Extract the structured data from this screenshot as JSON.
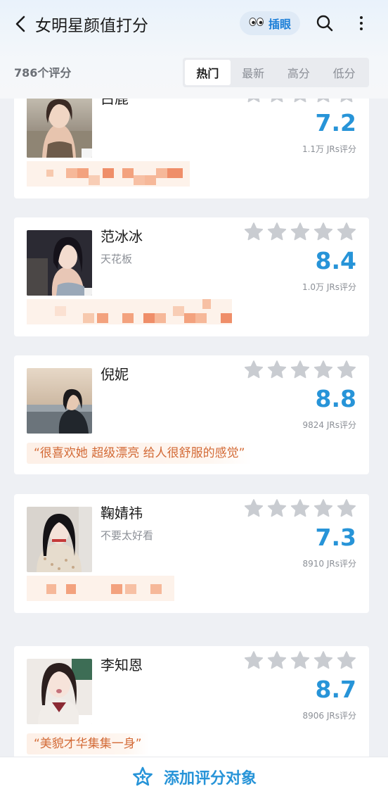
{
  "header": {
    "title": "女明星颜值打分",
    "eye_button_label": "插眼",
    "back_icon": "chevron-left-icon",
    "search_icon": "search-icon",
    "more_icon": "more-vertical-icon"
  },
  "summary": {
    "rating_count": "786个评分"
  },
  "tabs": [
    {
      "label": "热门",
      "active": true
    },
    {
      "label": "最新",
      "active": false
    },
    {
      "label": "高分",
      "active": false
    },
    {
      "label": "低分",
      "active": false
    }
  ],
  "colors": {
    "accent": "#2794d8",
    "star_inactive": "#c9ccd1",
    "comment_text": "#d36a36",
    "comment_bg": "#fdf0e7"
  },
  "items": [
    {
      "name": "白鹿",
      "subtitle": "",
      "score": "7.2",
      "raters": "1.1万 JRs评分",
      "comment": "",
      "comment_blurred": true
    },
    {
      "name": "范冰冰",
      "subtitle": "天花板",
      "score": "8.4",
      "raters": "1.0万 JRs评分",
      "comment": "",
      "comment_blurred": true
    },
    {
      "name": "倪妮",
      "subtitle": "",
      "score": "8.8",
      "raters": "9824 JRs评分",
      "comment": "“很喜欢她 超级漂亮 给人很舒服的感觉”",
      "comment_blurred": false
    },
    {
      "name": "鞠婧祎",
      "subtitle": "不要太好看",
      "score": "7.3",
      "raters": "8910 JRs评分",
      "comment": "",
      "comment_blurred": true
    },
    {
      "name": "李知恩",
      "subtitle": "",
      "score": "8.7",
      "raters": "8906 JRs评分",
      "comment": "“美貌才华集集一身”",
      "comment_blurred": false
    }
  ],
  "bottom": {
    "add_label": "添加评分对象",
    "add_icon": "star-add-icon"
  }
}
